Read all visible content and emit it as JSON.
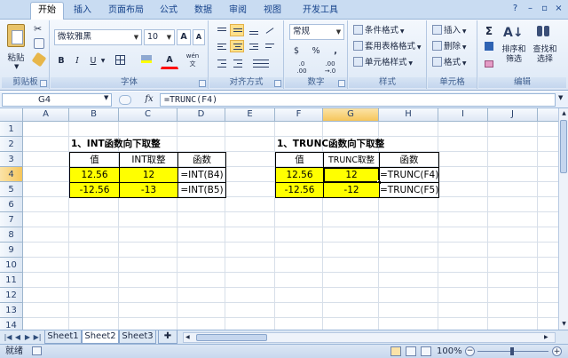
{
  "ribbon_tabs": [
    "开始",
    "插入",
    "页面布局",
    "公式",
    "数据",
    "审阅",
    "视图",
    "开发工具"
  ],
  "clipboard": {
    "paste": "粘贴",
    "label": "剪贴板"
  },
  "font": {
    "name": "微软雅黑",
    "size": "10",
    "grow": "A",
    "shrink": "A",
    "bold": "B",
    "italic": "I",
    "underline": "U",
    "label": "字体",
    "wen": "wén\n文"
  },
  "alignment": {
    "label": "对齐方式"
  },
  "number": {
    "format": "常规",
    "currency": "$",
    "percent": "%",
    "comma": ",",
    "inc": ".0\n.00",
    "dec": ".00\n→.0",
    "label": "数字"
  },
  "styles": {
    "cond": "条件格式",
    "table": "套用表格格式",
    "cell": "单元格样式",
    "label": "样式"
  },
  "cells": {
    "insert": "插入",
    "delete": "删除",
    "format": "格式",
    "label": "单元格"
  },
  "editing": {
    "sigma": "Σ",
    "sort": "排序和\n筛选",
    "find": "查找和\n选择",
    "label": "编辑"
  },
  "formula_bar": {
    "cell": "G4",
    "fx": "fx",
    "formula": "=TRUNC(F4)"
  },
  "columns": [
    "A",
    "B",
    "C",
    "D",
    "E",
    "F",
    "G",
    "H",
    "I",
    "J"
  ],
  "rows": [
    "1",
    "2",
    "3",
    "4",
    "5",
    "6",
    "7",
    "8",
    "9",
    "10",
    "11",
    "12",
    "13",
    "14"
  ],
  "table1": {
    "title": "1、INT函数向下取整",
    "headers": [
      "值",
      "INT取整",
      "函数"
    ],
    "rows": [
      [
        "12.56",
        "12",
        "=INT(B4)"
      ],
      [
        "-12.56",
        "-13",
        "=INT(B5)"
      ]
    ]
  },
  "table2": {
    "title": "1、TRUNC函数向下取整",
    "headers": [
      "值",
      "TRUNC取整",
      "函数"
    ],
    "rows": [
      [
        "12.56",
        "12",
        "=TRUNC(F4)"
      ],
      [
        "-12.56",
        "-12",
        "=TRUNC(F5)"
      ]
    ]
  },
  "sheets": [
    "Sheet1",
    "Sheet2",
    "Sheet3"
  ],
  "status": {
    "ready": "就绪",
    "zoom": "100%"
  },
  "colors": {
    "yellow": "#ffff00",
    "ribbon": "#dde8f6",
    "accent": "#15428b"
  }
}
